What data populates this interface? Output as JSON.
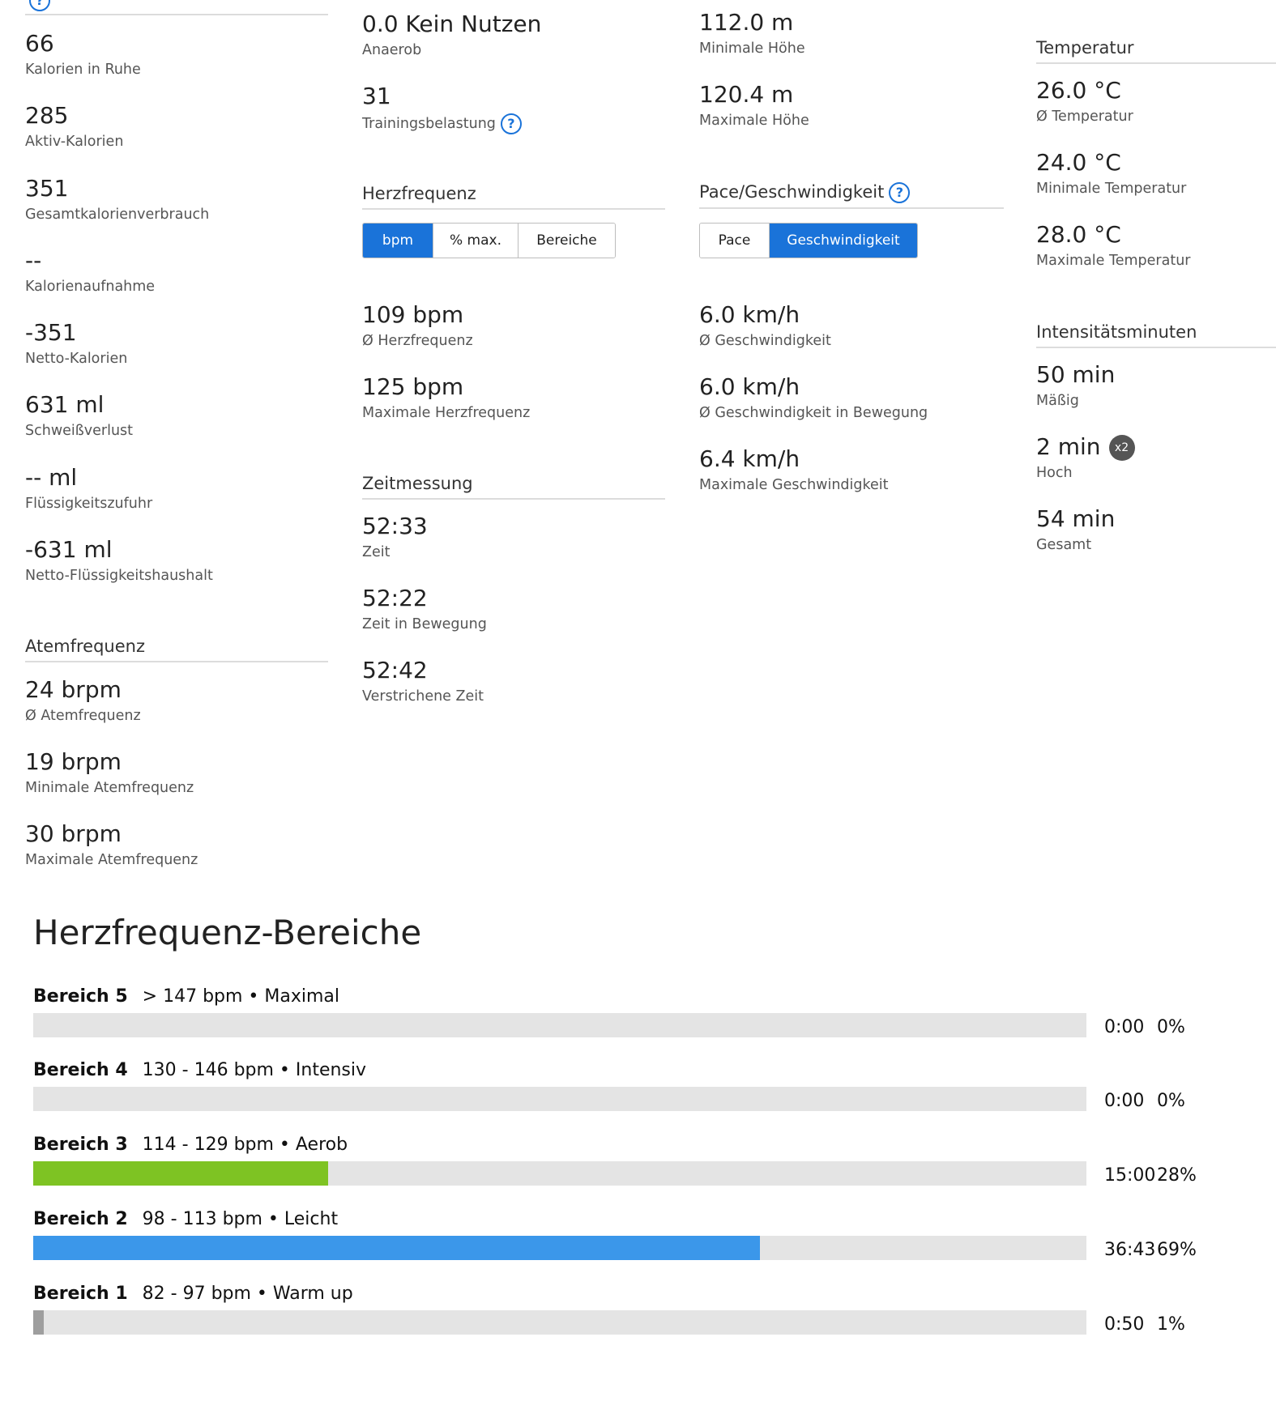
{
  "col1": {
    "stats": [
      {
        "value": "66",
        "label": "Kalorien in Ruhe"
      },
      {
        "value": "285",
        "label": "Aktiv-Kalorien"
      },
      {
        "value": "351",
        "label": "Gesamtkalorienverbrauch"
      },
      {
        "value": "--",
        "label": "Kalorienaufnahme"
      },
      {
        "value": "-351",
        "label": "Netto-Kalorien"
      },
      {
        "value": "631 ml",
        "label": "Schweißverlust"
      },
      {
        "value": "-- ml",
        "label": "Flüssigkeitszufuhr"
      },
      {
        "value": "-631 ml",
        "label": "Netto-Flüssigkeitshaushalt"
      }
    ],
    "breathing": {
      "title": "Atemfrequenz",
      "stats": [
        {
          "value": "24 brpm",
          "label": "Ø Atemfrequenz"
        },
        {
          "value": "19 brpm",
          "label": "Minimale Atemfrequenz"
        },
        {
          "value": "30 brpm",
          "label": "Maximale Atemfrequenz"
        }
      ]
    }
  },
  "col2": {
    "training": [
      {
        "value": "0.0 Kein Nutzen",
        "label": "Anaerob"
      },
      {
        "value": "31",
        "label": "Trainingsbelastung"
      }
    ],
    "heart_rate": {
      "title": "Herzfrequenz",
      "buttons": [
        "bpm",
        "% max.",
        "Bereiche"
      ],
      "active": "bpm",
      "stats": [
        {
          "value": "109 bpm",
          "label": "Ø Herzfrequenz"
        },
        {
          "value": "125 bpm",
          "label": "Maximale Herzfrequenz"
        }
      ]
    },
    "timing": {
      "title": "Zeitmessung",
      "stats": [
        {
          "value": "52:33",
          "label": "Zeit"
        },
        {
          "value": "52:22",
          "label": "Zeit in Bewegung"
        },
        {
          "value": "52:42",
          "label": "Verstrichene Zeit"
        }
      ]
    }
  },
  "col3": {
    "elevation": [
      {
        "value": "112.0 m",
        "label": "Minimale Höhe"
      },
      {
        "value": "120.4 m",
        "label": "Maximale Höhe"
      }
    ],
    "pace": {
      "title": "Pace/Geschwindigkeit",
      "buttons": [
        "Pace",
        "Geschwindigkeit"
      ],
      "active": "Geschwindigkeit",
      "stats": [
        {
          "value": "6.0 km/h",
          "label": "Ø Geschwindigkeit"
        },
        {
          "value": "6.0 km/h",
          "label": "Ø Geschwindigkeit in Bewegung"
        },
        {
          "value": "6.4 km/h",
          "label": "Maximale Geschwindigkeit"
        }
      ]
    }
  },
  "col4": {
    "temperature": {
      "title": "Temperatur",
      "stats": [
        {
          "value": "26.0 °C",
          "label": "Ø Temperatur"
        },
        {
          "value": "24.0 °C",
          "label": "Minimale Temperatur"
        },
        {
          "value": "28.0 °C",
          "label": "Maximale Temperatur"
        }
      ]
    },
    "intensity": {
      "title": "Intensitätsminuten",
      "stats": [
        {
          "value": "50 min",
          "label": "Mäßig"
        },
        {
          "value": "2 min",
          "label": "Hoch",
          "badge": "x2"
        },
        {
          "value": "54 min",
          "label": "Gesamt"
        }
      ]
    }
  },
  "help_glyph": "?",
  "colors": {
    "accent": "#1a73d9",
    "zone3": "#7ec323",
    "zone2": "#3b97ea",
    "zone1": "#9e9e9e",
    "track": "#e4e4e4"
  },
  "zones": {
    "title": "Herzfrequenz-Bereiche",
    "items": [
      {
        "name": "Bereich 5",
        "range": "> 147 bpm • Maximal",
        "time": "0:00",
        "pct": "0%",
        "fraction": 0.0
      },
      {
        "name": "Bereich 4",
        "range": "130 - 146 bpm • Intensiv",
        "time": "0:00",
        "pct": "0%",
        "fraction": 0.0
      },
      {
        "name": "Bereich 3",
        "range": "114 - 129 bpm • Aerob",
        "time": "15:00",
        "pct": "28%",
        "fraction": 0.28
      },
      {
        "name": "Bereich 2",
        "range": "98 - 113 bpm • Leicht",
        "time": "36:43",
        "pct": "69%",
        "fraction": 0.69
      },
      {
        "name": "Bereich 1",
        "range": "82 - 97 bpm • Warm up",
        "time": "0:50",
        "pct": "1%",
        "fraction": 0.01
      }
    ]
  }
}
